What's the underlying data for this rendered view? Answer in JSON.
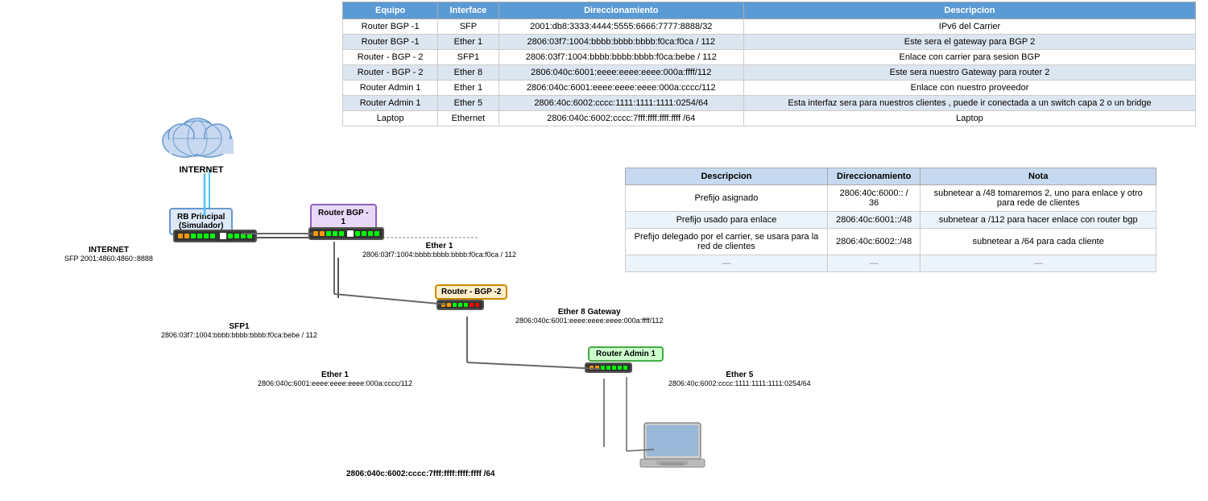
{
  "tables": {
    "main": {
      "headers": [
        "Equipo",
        "Interface",
        "Direccionamiento",
        "Descripcion"
      ],
      "rows": [
        [
          "Router BGP -1",
          "SFP",
          "2001:db8:3333:4444:5555:6666:7777:8888/32",
          "IPv6 del Carrier"
        ],
        [
          "Router BGP -1",
          "Ether 1",
          "2806:03f7:1004:bbbb:bbbb:bbbb:f0ca:f0ca / 112",
          "Este sera el gateway para BGP 2"
        ],
        [
          "Router - BGP - 2",
          "SFP1",
          "2806:03f7:1004:bbbb:bbbb:bbbb:f0ca:bebe / 112",
          "Enlace con carrier para sesion BGP"
        ],
        [
          "Router - BGP - 2",
          "Ether 8",
          "2806:040c:6001:eeee:eeee:eeee:000a:ffff/112",
          "Este sera nuestro Gateway para router 2"
        ],
        [
          "Router Admin 1",
          "Ether 1",
          "2806:040c:6001:eeee:eeee:eeee:000a:cccc/112",
          "Enlace con nuestro proveedor"
        ],
        [
          "Router Admin 1",
          "Ether 5",
          "2806:40c:6002:cccc:1111:1111:1111:0254/64",
          "Esta interfaz sera para nuestros clientes , puede ir conectada a un switch capa 2 o un bridge"
        ],
        [
          "Laptop",
          "Ethernet",
          "2806:040c:6002:cccc:7fff:ffff:ffff:ffff /64",
          "Laptop"
        ]
      ]
    },
    "second": {
      "headers": [
        "Descripcion",
        "Direccionamiento",
        "Nota"
      ],
      "rows": [
        [
          "Prefijo asignado",
          "2806:40c:6000:: / 36",
          "subnetear a /48  tomaremos 2, uno para enlace y otro para rede de clientes"
        ],
        [
          "Prefijo usado para enlace",
          "2806:40c:6001::/48",
          "subnetear a /112 para hacer enlace con router bgp"
        ],
        [
          "Prefijo delegado por el carrier, se usara para la red de clientes",
          "2806:40c:6002::/48",
          "subnetear a /64 para cada cliente"
        ],
        [
          "—",
          "—",
          "—"
        ]
      ]
    }
  },
  "diagram": {
    "internet_label": "INTERNET",
    "rb_principal_label": "RB Principal\n(Simulador)",
    "router_bgp_label": "Router BGP -\n1",
    "router_bgp2_label": "Router - BGP -2",
    "router_admin_label": "Router Admin 1",
    "internet_sfp_text": "INTERNET\nSFP 2001:4860:4860::8888",
    "ether1_bgp_text": "Ether 1\n2806:03f7:1004:bbbb:bbbb:bbbb:f0ca:f0ca / 112",
    "sfp1_text": "SFP1\n2806:03f7:1004:bbbb:bbbb:bbbb:f0ca:bebe / 112",
    "ether8_text": "Ether 8 Gateway\n2806:040c:6001:eeee:eeee:eeee:000a:ffff/112",
    "ether1_admin_text": "Ether 1\n2806:040c:6001:eeee:eeee:eeee:000a:cccc/112",
    "ether5_text": "Ether 5\n2806:40c:6002:cccc:1111:1111:1111:0254/64",
    "laptop_addr": "2806:040c:6002:cccc:7fff:ffff:ffff:ffff /64",
    "laptop_label": "Laptop"
  }
}
